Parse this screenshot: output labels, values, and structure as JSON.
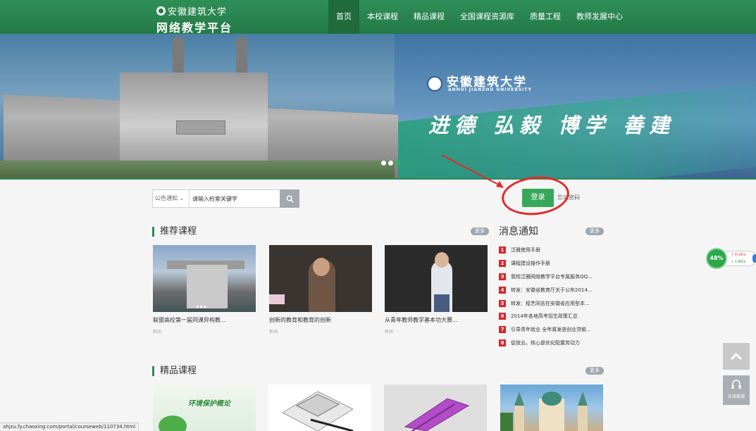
{
  "header": {
    "logo_line1": "安徽建筑大学",
    "logo_line2": "网络教学平台",
    "nav": [
      "首页",
      "本校课程",
      "精品课程",
      "全国课程资源库",
      "质量工程",
      "教师发展中心"
    ],
    "active_nav": "首页"
  },
  "banner": {
    "university_name": "安徽建筑大学",
    "university_name_en": "ANHUI JIANZHU UNIVERSITY",
    "motto": "进德 弘毅 博学 善建",
    "slide_count": 3,
    "active_slide": 3
  },
  "search": {
    "category": "公告通知",
    "placeholder": "请输入检索关键字"
  },
  "login": {
    "button": "登录",
    "forgot": "忘记密码"
  },
  "recommended": {
    "title": "推荐课程",
    "more": "更多",
    "courses": [
      {
        "title": "联盟高校第一届同课异构教...",
        "sub": "新闻"
      },
      {
        "title": "创新的教育和教育的创新",
        "sub": "新闻"
      },
      {
        "title": "从青年教师教学基本功大赛...",
        "sub": "新闻"
      }
    ]
  },
  "news": {
    "title": "消息通知",
    "more": "更多",
    "items": [
      {
        "num": "1",
        "text": "泛雅使用手册"
      },
      {
        "num": "2",
        "text": "课程建设操作手册"
      },
      {
        "num": "3",
        "text": "我校泛雅网络教学平台专属服务QQ..."
      },
      {
        "num": "4",
        "text": "转发：安徽省教育厅关于公布2014..."
      },
      {
        "num": "5",
        "text": "转发：程艺同志在安徽省应用型本..."
      },
      {
        "num": "6",
        "text": "2014年各地高考招生政策汇总"
      },
      {
        "num": "7",
        "text": "引导青年就业 全年將发放创业贷款..."
      },
      {
        "num": "8",
        "text": "促就业，核心是优化配置劳动力"
      }
    ]
  },
  "featured": {
    "title": "精品课程",
    "more": "更多",
    "card1_text": "环境保护概论"
  },
  "widgets": {
    "net_percent": "48%",
    "up_speed": "0.1K/s",
    "down_speed": "1.4K/s",
    "service_label": "在线客服"
  },
  "status_url": "ahjzu.fy.chaoxing.com/portal/courseweb/110734.html"
}
